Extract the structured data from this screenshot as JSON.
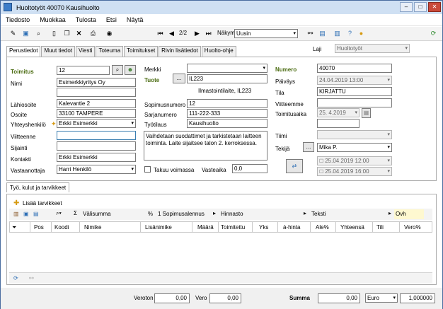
{
  "window": {
    "title": "Huoltotyöt 40070 Kausihuolto"
  },
  "menu": [
    "Tiedosto",
    "Muokkaa",
    "Tulosta",
    "Etsi",
    "Näytä"
  ],
  "toolbar": {
    "page": "2/2",
    "view_label": "Näkymä",
    "view_value": "Uusin"
  },
  "tabs": [
    "Perustiedot",
    "Muut tiedot",
    "Viesti",
    "Toteuma",
    "Toimitukset",
    "Rivin lisätiedot",
    "Huolto-ohje"
  ],
  "laji": {
    "label": "Laji",
    "value": "Huoltotyöt"
  },
  "left": {
    "toimitus_label": "Toimitus",
    "toimitus": "12",
    "nimi_label": "Nimi",
    "nimi": "Esimerkkiyritys Oy",
    "lahiosoite_label": "Lähiosoite",
    "lahiosoite": "Kalevantie 2",
    "osoite_label": "Osoite",
    "osoite": "33100  TAMPERE",
    "yhteyshenkilo_label": "Yhteyshenkilö",
    "yhteyshenkilo": "Erkki Esimerkki",
    "viitteenne_label": "Viitteenne",
    "sijainti_label": "Sijainti",
    "kontakti_label": "Kontakti",
    "kontakti": "Erkki Esimerkki",
    "vastaanottaja_label": "Vastaanottaja",
    "vastaanottaja": "Harri Henkilö"
  },
  "mid": {
    "merkki_label": "Merkki",
    "tuote_label": "Tuote",
    "tuote": "IL223",
    "tuote_desc": "Ilmastointilaite, IL223",
    "sopimusnumero_label": "Sopimusnumero",
    "sopimusnumero": "12",
    "sarjanumero_label": "Sarjanumero",
    "sarjanumero": "111-222-333",
    "tyotilaus_label": "Työtilaus",
    "tyotilaus": "Kausihuolto",
    "notes": "Vaihdetaan suodattimet ja tarkistetaan laitteen toiminta. Laite sijaitsee talon 2. kerroksessa.",
    "takuu_label": "Takuu voimassa",
    "vasteaika_label": "Vasteaika",
    "vasteaika": "0,0"
  },
  "right": {
    "numero_label": "Numero",
    "numero": "40070",
    "paivays_label": "Päiväys",
    "paivays": "24.04.2019 13:00",
    "tila_label": "Tila",
    "tila": "KIRJATTU",
    "viitteemme_label": "Viitteemme",
    "toimitusaika_label": "Toimitusaika",
    "toimitusaika": "25.  4.2019",
    "tiimi_label": "Tiimi",
    "tekija_label": "Tekijä",
    "tekija": "Mika P.",
    "start": "25.04.2019 12:00",
    "end": "25.04.2019 16:00"
  },
  "section": {
    "tab": "Työ, kulut ja tarvikkeet",
    "add_label": "Lisää tarvikkeet",
    "sum_label": "Välisumma",
    "pct_label": "%",
    "contract_label": "1 Sopimusalennus",
    "price_label": "Hinnasto",
    "text_label": "Teksti",
    "ovh_label": "Ovh",
    "columns": [
      "Pos",
      "Koodi",
      "Nimike",
      "Lisänimike",
      "Määrä",
      "Toimitettu",
      "Yks",
      "á-hinta",
      "Ale%",
      "Yhteensä",
      "Tili",
      "Vero%"
    ]
  },
  "footer": {
    "veroton_label": "Veroton",
    "veroton": "0,00",
    "vero_label": "Vero",
    "vero": "0,00",
    "summa_label": "Summa",
    "summa": "0,00",
    "currency": "Euro",
    "rate": "1,000000"
  }
}
